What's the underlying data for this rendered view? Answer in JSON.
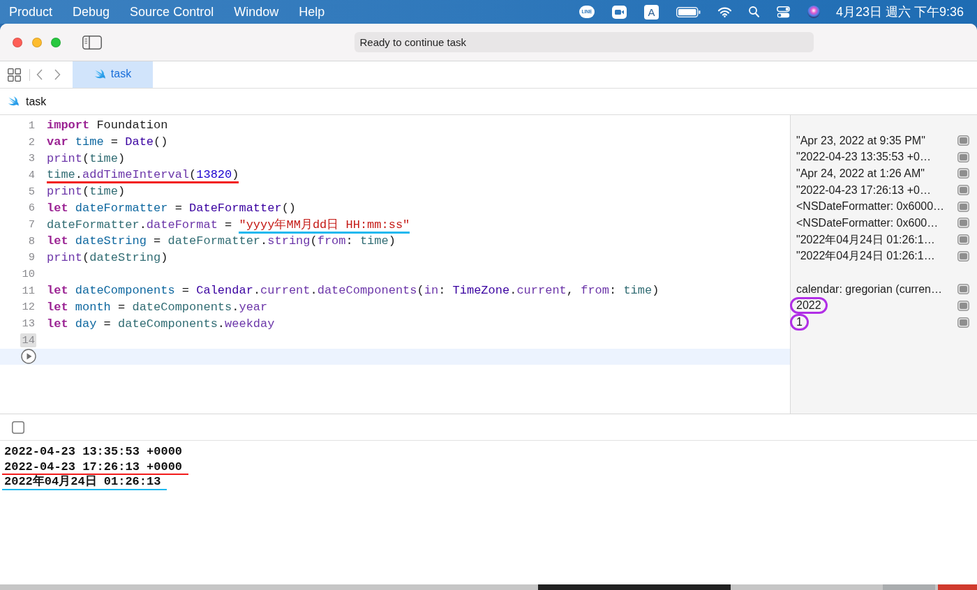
{
  "menu_bar": {
    "menus": [
      "Product",
      "Debug",
      "Source Control",
      "Window",
      "Help"
    ],
    "status_items": [
      {
        "kind": "line",
        "text": "LINE"
      },
      {
        "kind": "video"
      },
      {
        "kind": "input",
        "text": "A"
      },
      {
        "kind": "battery"
      },
      {
        "kind": "wifi"
      },
      {
        "kind": "search"
      },
      {
        "kind": "controls"
      },
      {
        "kind": "siri"
      }
    ],
    "clock": "4月23日 週六 下午9:36"
  },
  "window": {
    "status": "Ready to continue task"
  },
  "tabs": [
    {
      "label": "task",
      "selected": true
    }
  ],
  "breadcrumb": [
    "task"
  ],
  "editor": {
    "lines": [
      {
        "number": "1",
        "highlighted": false,
        "tokens": [
          {
            "kind": "keyword",
            "text": "import "
          },
          {
            "kind": "plain",
            "text": "Foundation"
          }
        ]
      },
      {
        "number": "2",
        "highlighted": false,
        "tokens": [
          {
            "kind": "keyword",
            "text": "var "
          },
          {
            "kind": "declaration",
            "text": "time"
          },
          {
            "kind": "plain",
            "text": " = "
          },
          {
            "kind": "type",
            "text": "Date"
          },
          {
            "kind": "plain",
            "text": "()"
          }
        ],
        "result": {
          "text": "\"Apr 23, 2022 at 9:35 PM\"",
          "circled": false
        }
      },
      {
        "number": "3",
        "highlighted": false,
        "tokens": [
          {
            "kind": "member",
            "text": "print"
          },
          {
            "kind": "plain",
            "text": "("
          },
          {
            "kind": "variable",
            "text": "time"
          },
          {
            "kind": "plain",
            "text": ")"
          }
        ],
        "result": {
          "text": "\"2022-04-23 13:35:53 +0…",
          "circled": false
        }
      },
      {
        "number": "4",
        "highlighted": false,
        "tokens": [
          {
            "kind": "variable",
            "text": "time",
            "underline": {
              "color": "#f21b1b"
            }
          },
          {
            "kind": "plain",
            "text": ".",
            "underline": {
              "color": "#f21b1b"
            }
          },
          {
            "kind": "member",
            "text": "addTimeInterval",
            "underline": {
              "color": "#f21b1b"
            }
          },
          {
            "kind": "plain",
            "text": "(",
            "underline": {
              "color": "#f21b1b"
            }
          },
          {
            "kind": "number",
            "text": "13820",
            "underline": {
              "color": "#f21b1b"
            }
          },
          {
            "kind": "plain",
            "text": ")",
            "underline": {
              "color": "#f21b1b"
            }
          }
        ],
        "result": {
          "text": "\"Apr 24, 2022 at 1:26 AM\"",
          "circled": false
        }
      },
      {
        "number": "5",
        "highlighted": false,
        "tokens": [
          {
            "kind": "member",
            "text": "print"
          },
          {
            "kind": "plain",
            "text": "("
          },
          {
            "kind": "variable",
            "text": "time"
          },
          {
            "kind": "plain",
            "text": ")"
          }
        ],
        "result": {
          "text": "\"2022-04-23 17:26:13 +0…",
          "circled": false
        }
      },
      {
        "number": "6",
        "highlighted": false,
        "tokens": [
          {
            "kind": "keyword",
            "text": "let "
          },
          {
            "kind": "declaration",
            "text": "dateFormatter"
          },
          {
            "kind": "plain",
            "text": " = "
          },
          {
            "kind": "type",
            "text": "DateFormatter"
          },
          {
            "kind": "plain",
            "text": "()"
          }
        ],
        "result": {
          "text": "<NSDateFormatter: 0x6000…",
          "circled": false
        }
      },
      {
        "number": "7",
        "highlighted": false,
        "tokens": [
          {
            "kind": "variable",
            "text": "dateFormatter"
          },
          {
            "kind": "plain",
            "text": "."
          },
          {
            "kind": "member",
            "text": "dateFormat"
          },
          {
            "kind": "plain",
            "text": " = "
          },
          {
            "kind": "string",
            "text": "\"yyyy年MM月dd日 HH:mm:ss\"",
            "underline": {
              "color": "#1db8ef"
            }
          }
        ],
        "result": {
          "text": "<NSDateFormatter: 0x600…",
          "circled": false
        }
      },
      {
        "number": "8",
        "highlighted": false,
        "tokens": [
          {
            "kind": "keyword",
            "text": "let "
          },
          {
            "kind": "declaration",
            "text": "dateString"
          },
          {
            "kind": "plain",
            "text": " = "
          },
          {
            "kind": "variable",
            "text": "dateFormatter"
          },
          {
            "kind": "plain",
            "text": "."
          },
          {
            "kind": "member",
            "text": "string"
          },
          {
            "kind": "plain",
            "text": "("
          },
          {
            "kind": "member",
            "text": "from"
          },
          {
            "kind": "plain",
            "text": ": "
          },
          {
            "kind": "variable",
            "text": "time"
          },
          {
            "kind": "plain",
            "text": ")"
          }
        ],
        "result": {
          "text": "\"2022年04月24日 01:26:1…",
          "circled": false
        }
      },
      {
        "number": "9",
        "highlighted": false,
        "tokens": [
          {
            "kind": "member",
            "text": "print"
          },
          {
            "kind": "plain",
            "text": "("
          },
          {
            "kind": "variable",
            "text": "dateString"
          },
          {
            "kind": "plain",
            "text": ")"
          }
        ],
        "result": {
          "text": "\"2022年04月24日 01:26:1…",
          "circled": false
        }
      },
      {
        "number": "10",
        "highlighted": false
      },
      {
        "number": "11",
        "highlighted": false,
        "tokens": [
          {
            "kind": "keyword",
            "text": "let "
          },
          {
            "kind": "declaration",
            "text": "dateComponents"
          },
          {
            "kind": "plain",
            "text": " = "
          },
          {
            "kind": "type",
            "text": "Calendar"
          },
          {
            "kind": "plain",
            "text": "."
          },
          {
            "kind": "member",
            "text": "current"
          },
          {
            "kind": "plain",
            "text": "."
          },
          {
            "kind": "member",
            "text": "dateComponents"
          },
          {
            "kind": "plain",
            "text": "("
          },
          {
            "kind": "member",
            "text": "in"
          },
          {
            "kind": "plain",
            "text": ": "
          },
          {
            "kind": "type",
            "text": "TimeZone"
          },
          {
            "kind": "plain",
            "text": "."
          },
          {
            "kind": "member",
            "text": "current"
          },
          {
            "kind": "plain",
            "text": ", "
          },
          {
            "kind": "member",
            "text": "from"
          },
          {
            "kind": "plain",
            "text": ": "
          },
          {
            "kind": "variable",
            "text": "time"
          },
          {
            "kind": "plain",
            "text": ")"
          }
        ],
        "result": {
          "text": "calendar: gregorian (curren…",
          "circled": false
        }
      },
      {
        "number": "12",
        "highlighted": false,
        "tokens": [
          {
            "kind": "keyword",
            "text": "let "
          },
          {
            "kind": "declaration",
            "text": "month"
          },
          {
            "kind": "plain",
            "text": " = "
          },
          {
            "kind": "variable",
            "text": "dateComponents"
          },
          {
            "kind": "plain",
            "text": "."
          },
          {
            "kind": "member",
            "text": "year"
          }
        ],
        "result": {
          "text": "2022",
          "circled": true
        }
      },
      {
        "number": "13",
        "highlighted": false,
        "tokens": [
          {
            "kind": "keyword",
            "text": "let "
          },
          {
            "kind": "declaration",
            "text": "day"
          },
          {
            "kind": "plain",
            "text": " = "
          },
          {
            "kind": "variable",
            "text": "dateComponents"
          },
          {
            "kind": "plain",
            "text": "."
          },
          {
            "kind": "member",
            "text": "weekday"
          }
        ],
        "result": {
          "text": "1",
          "circled": true
        }
      },
      {
        "number": "14",
        "highlighted": true
      }
    ],
    "run_row": {
      "highlighted": true
    }
  },
  "console": {
    "lines": [
      {
        "text": "2022-04-23 13:35:53 +0000"
      },
      {
        "text": "2022-04-23 17:26:13 +0000",
        "underline": {
          "color": "#f21b1b"
        }
      },
      {
        "text": "2022年04月24日 01:26:13",
        "underline": {
          "color": "#1db8ef"
        }
      }
    ]
  }
}
